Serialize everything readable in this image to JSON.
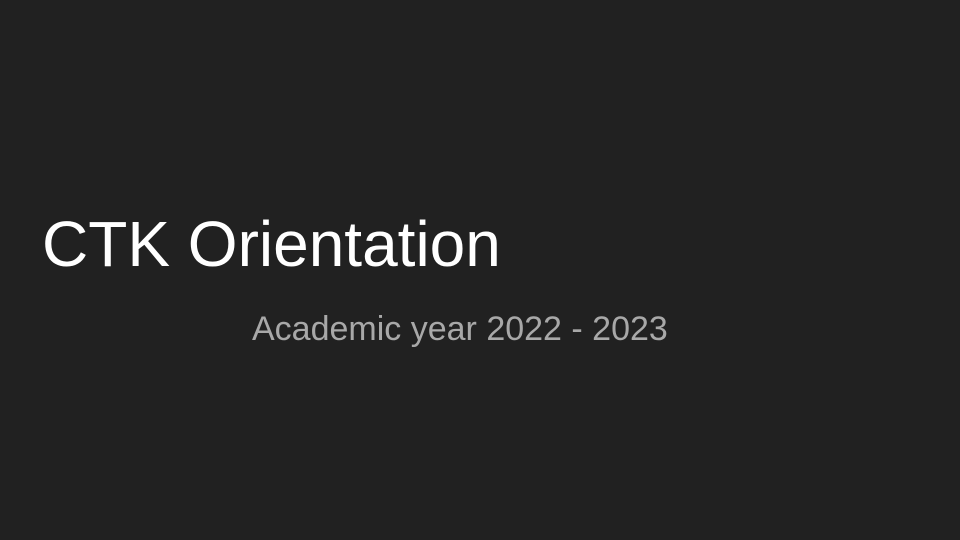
{
  "slide": {
    "title": "CTK Orientation",
    "subtitle": "Academic year 2022 - 2023",
    "background_color": "#212121",
    "title_color": "#ffffff",
    "subtitle_color": "#a8a8a8"
  }
}
